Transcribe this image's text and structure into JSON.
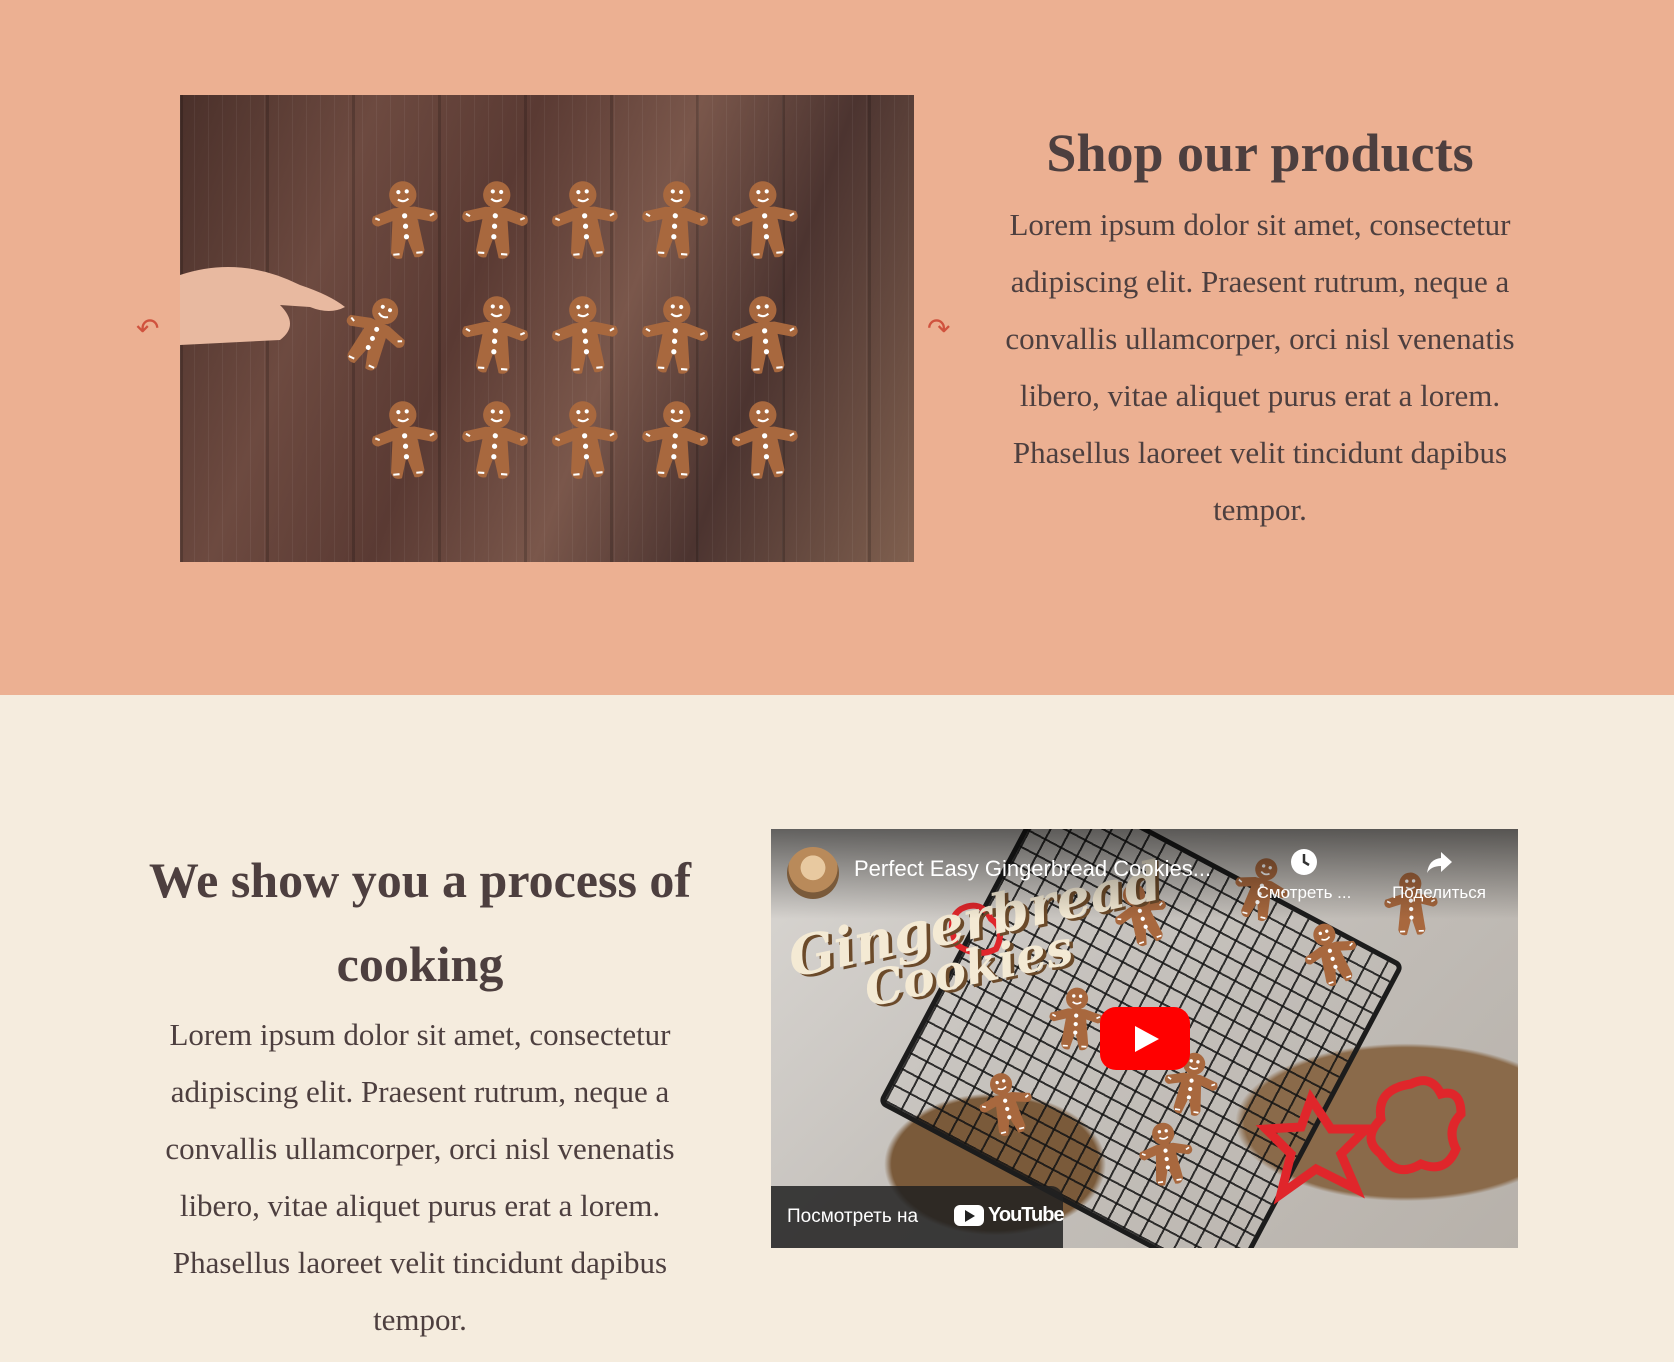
{
  "shop": {
    "title": "Shop our products",
    "body": "Lorem ipsum dolor sit amet, consectetur adipiscing elit. Praesent rutrum, neque a convallis ullamcorper, orci nisl venenatis libero, vitae aliquet purus erat a lorem. Phasellus laoreet velit tincidunt dapibus tempor.",
    "prev_arrow": "↶",
    "next_arrow": "↷"
  },
  "process": {
    "title": "We show you a process of cooking",
    "body": "Lorem ipsum dolor sit amet, consectetur adipiscing elit. Praesent rutrum, neque a convallis ullamcorper, orci nisl venenatis libero, vitae aliquet purus erat a lorem. Phasellus laoreet velit tincidunt dapibus tempor."
  },
  "video": {
    "title": "Perfect Easy Gingerbread Cookies...",
    "watch_later": "Смотреть ...",
    "share": "Поделиться",
    "watch_on": "Посмотреть на",
    "platform": "YouTube",
    "overlay_line1": "Gingerbread",
    "overlay_line2": "Cookies"
  },
  "colors": {
    "top_bg": "#ecb092",
    "bottom_bg": "#f5ecde",
    "text": "#4d3f3f",
    "arrow": "#d0523e",
    "play": "#ff0000"
  }
}
